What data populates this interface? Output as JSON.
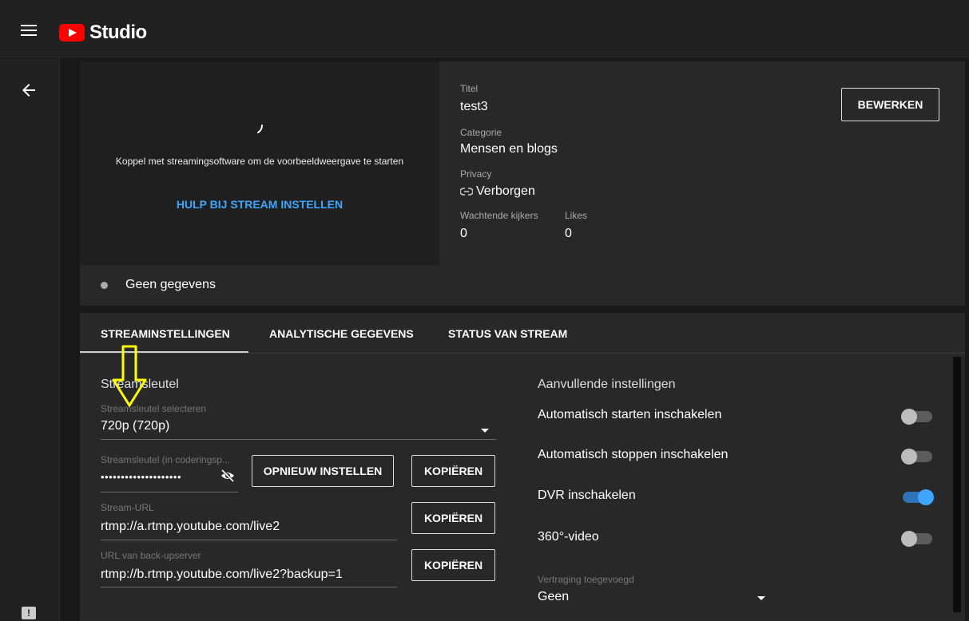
{
  "app": {
    "logo_text": "Studio"
  },
  "preview": {
    "message": "Koppel met streamingsoftware om de voorbeeldweergave te starten",
    "help_link": "HULP BIJ STREAM INSTELLEN"
  },
  "details": {
    "title_label": "Titel",
    "title_value": "test3",
    "category_label": "Categorie",
    "category_value": "Mensen en blogs",
    "privacy_label": "Privacy",
    "privacy_value": "Verborgen",
    "waiting_label": "Wachtende kijkers",
    "waiting_value": "0",
    "likes_label": "Likes",
    "likes_value": "0",
    "edit_button": "BEWERKEN"
  },
  "status": {
    "text": "Geen gegevens"
  },
  "tabs": [
    {
      "label": "STREAMINSTELLINGEN",
      "active": true
    },
    {
      "label": "ANALYTISCHE GEGEVENS",
      "active": false
    },
    {
      "label": "STATUS VAN STREAM",
      "active": false
    }
  ],
  "stream_key": {
    "section_title": "Streamsleutel",
    "select_label": "Streamsleutel selecteren",
    "select_value": "720p (720p)",
    "key_label": "Streamsleutel (in coderingsp...",
    "key_value": "••••••••••••••••••••",
    "reset_button": "OPNIEUW INSTELLEN",
    "copy_button": "KOPIËREN",
    "url_label": "Stream-URL",
    "url_value": "rtmp://a.rtmp.youtube.com/live2",
    "backup_label": "URL van back-upserver",
    "backup_value": "rtmp://b.rtmp.youtube.com/live2?backup=1"
  },
  "additional": {
    "section_title": "Aanvullende instellingen",
    "settings": [
      {
        "label": "Automatisch starten inschakelen",
        "on": false
      },
      {
        "label": "Automatisch stoppen inschakelen",
        "on": false
      },
      {
        "label": "DVR inschakelen",
        "on": true
      },
      {
        "label": "360°-video",
        "on": false
      }
    ],
    "latency_label": "Vertraging toegevoegd",
    "latency_value": "Geen"
  },
  "colors": {
    "accent": "#3ea6ff",
    "brand": "#ff0000",
    "annotation": "#ffff00"
  }
}
